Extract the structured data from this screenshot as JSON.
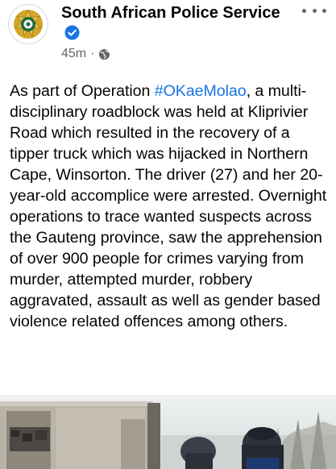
{
  "post": {
    "page_name": "South African Police Service",
    "verified_icon": "verified-badge-icon",
    "time_ago": "45m",
    "separator": "·",
    "audience_icon": "globe-icon",
    "more_icon": "more-options-icon",
    "body_pre": "As part of Operation ",
    "hashtag": "#OKaeMolao",
    "body_post": ", a multi-disciplinary roadblock was held at Kliprivier Road which resulted in the recovery of a tipper truck which was hijacked in Northern Cape, Winsorton. The driver (27) and her 20-year-old accomplice were arrested. Overnight operations to trace wanted suspects across the Gauteng province, saw the apprehension of over 900 people for crimes varying from murder, attempted murder, robbery aggravated, assault as well as gender based violence related offences among others.",
    "photo": "photo of tipper truck and police officers"
  },
  "colors": {
    "text": "#050505",
    "secondary": "#65676b",
    "link": "#1b74e4",
    "verified": "#1b74e4",
    "logo_green": "#1f6b3a",
    "logo_gold": "#d4a62a"
  }
}
